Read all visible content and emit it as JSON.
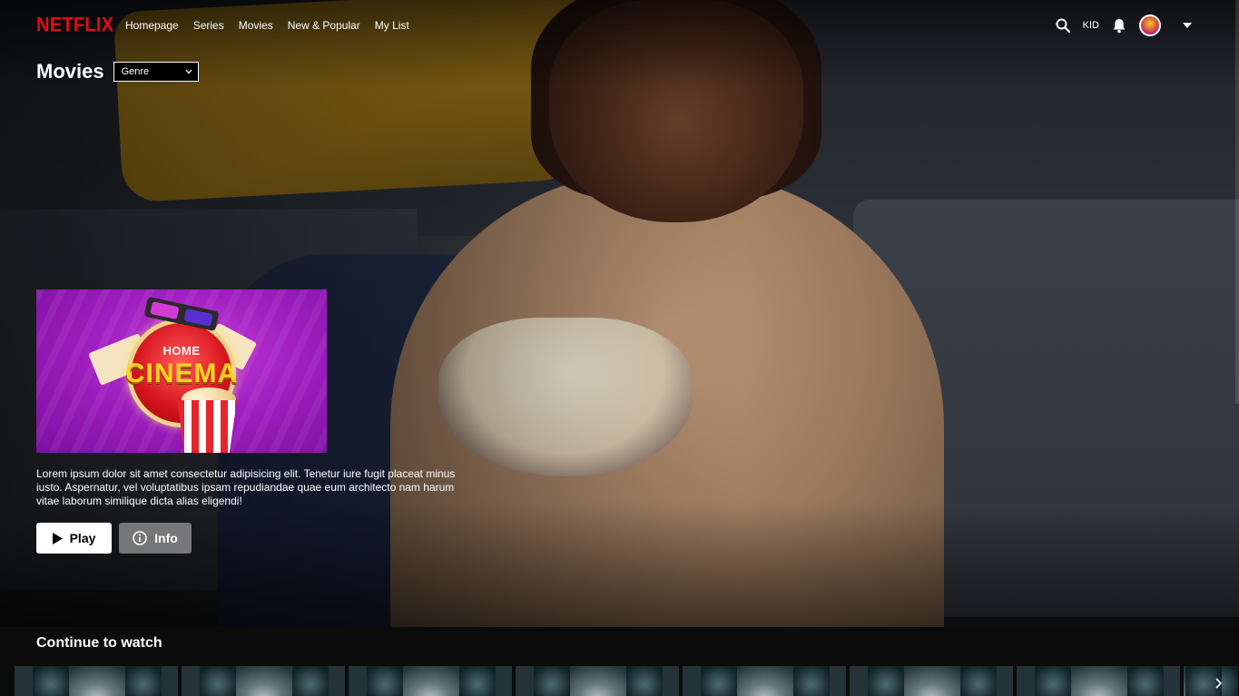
{
  "nav": {
    "logo": "NETFLIX",
    "links": [
      "Homepage",
      "Series",
      "Movies",
      "New & Popular",
      "My List"
    ],
    "kid_label": "KID",
    "icons": {
      "search": "search-icon",
      "notifications": "bell-icon",
      "profile_menu": "caret-down-icon"
    }
  },
  "header": {
    "title": "Movies",
    "genre_select": {
      "selected": "Genre"
    }
  },
  "featured": {
    "art_text_top": "HOME",
    "art_text_main": "CINEMA",
    "description": "Lorem ipsum dolor sit amet consectetur adipisicing elit. Tenetur iure fugit placeat minus iusto. Aspernatur, vel voluptatibus ipsam repudiandae quae eum architecto nam harum vitae laborum similique dicta alias eligendi!",
    "play_label": "Play",
    "info_label": "Info"
  },
  "row": {
    "title": "Continue to watch",
    "thumb_count": 8
  },
  "colors": {
    "brand": "#e50914",
    "background": "#0b0b0b",
    "play_button": "#ffffff",
    "info_button": "#8f8f8f"
  }
}
